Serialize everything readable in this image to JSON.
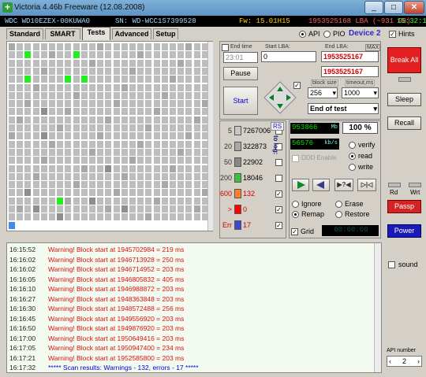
{
  "window": {
    "title": "Victoria 4.46b Freeware (12.08.2008)",
    "min": "_",
    "max": "□",
    "close": "✕"
  },
  "info": {
    "model": "WDC WD10EZEX-00KUWA0",
    "serial": "SN: WD-WCC1S7399528",
    "firmware": "Fw: 15.01H15",
    "lba": "1953525168 LBA (~931 GB)",
    "time": "15:32:19"
  },
  "tabs": [
    "Standard",
    "SMART",
    "Tests",
    "Advanced",
    "Setup"
  ],
  "mode": {
    "api": "API",
    "pio": "PIO",
    "device": "Device 2",
    "hints": "Hints"
  },
  "lba": {
    "end_time_label": "End time",
    "end_time": "23:01",
    "start_label": "Start LBA:",
    "start_value": "0",
    "end_label": "End LBA:",
    "max_label": "MAX",
    "end_value": "1953525167",
    "current_value": "1953525167",
    "block_label": "block size",
    "block_value": "256",
    "timeout_label": "timeout,ms",
    "timeout_value": "1000",
    "end_of_test": "End of test"
  },
  "controls": {
    "pause": "Pause",
    "start": "Start",
    "break_all": "Break All",
    "sleep": "Sleep",
    "recall": "Recall",
    "passp": "Passp",
    "power": "Power",
    "sound": "sound",
    "rd": "Rd",
    "wrt": "Wrt",
    "api_number_label": "API number",
    "api_number": "2"
  },
  "stats": {
    "rs": "RS",
    "to_log": "to log:",
    "rows": [
      {
        "ms": "5",
        "count": "7267006",
        "color": "#c8c8c8",
        "checked": false
      },
      {
        "ms": "20",
        "count": "322873",
        "color": "#a8a8a8",
        "checked": false
      },
      {
        "ms": "50",
        "count": "22902",
        "color": "#888888",
        "checked": false
      },
      {
        "ms": "200",
        "count": "18046",
        "color": "#3fbf3f",
        "checked": false
      },
      {
        "ms": "600",
        "count": "132",
        "color": "#ff7f27",
        "checked": true
      },
      {
        "ms": ">",
        "count": "0",
        "color": "#ff0000",
        "checked": true
      },
      {
        "ms": "Err",
        "count": "17",
        "color": "#3f48cc",
        "checked": true
      }
    ]
  },
  "progress": {
    "mb": "953866",
    "mb_unit": "Mb",
    "percent": "100",
    "percent_unit": "%",
    "speed": "56576",
    "speed_unit": "kb/s",
    "ddd": "DDD Enable",
    "verify": "verify",
    "read": "read",
    "write": "write",
    "ignore": "Ignore",
    "erase": "Erase",
    "remap": "Remap",
    "restore": "Restore",
    "grid": "Grid",
    "grid_time": "00:00:00"
  },
  "log": [
    {
      "t": "16:15:52",
      "m": "Warning! Block start at 1945702984 = 219 ms"
    },
    {
      "t": "16:16:02",
      "m": "Warning! Block start at 1946713928 = 250 ms"
    },
    {
      "t": "16:16:02",
      "m": "Warning! Block start at 1946714952 = 203 ms"
    },
    {
      "t": "16:16:05",
      "m": "Warning! Block start at 1946805832 = 405 ms"
    },
    {
      "t": "16:16:10",
      "m": "Warning! Block start at 1946988872 = 203 ms"
    },
    {
      "t": "16:16:27",
      "m": "Warning! Block start at 1948363848 = 203 ms"
    },
    {
      "t": "16:16:30",
      "m": "Warning! Block start at 1948572488 = 256 ms"
    },
    {
      "t": "16:16:45",
      "m": "Warning! Block start at 1949556920 = 203 ms"
    },
    {
      "t": "16:16:50",
      "m": "Warning! Block start at 1949876920 = 203 ms"
    },
    {
      "t": "16:17:00",
      "m": "Warning! Block start at 1950649416 = 203 ms"
    },
    {
      "t": "16:17:05",
      "m": "Warning! Block start at 1950947400 = 234 ms"
    },
    {
      "t": "16:17:21",
      "m": "Warning! Block start at 1952585800 = 203 ms"
    },
    {
      "t": "16:17:32",
      "m": "***** Scan results: Warnings - 132, errors - 17 *****"
    }
  ]
}
